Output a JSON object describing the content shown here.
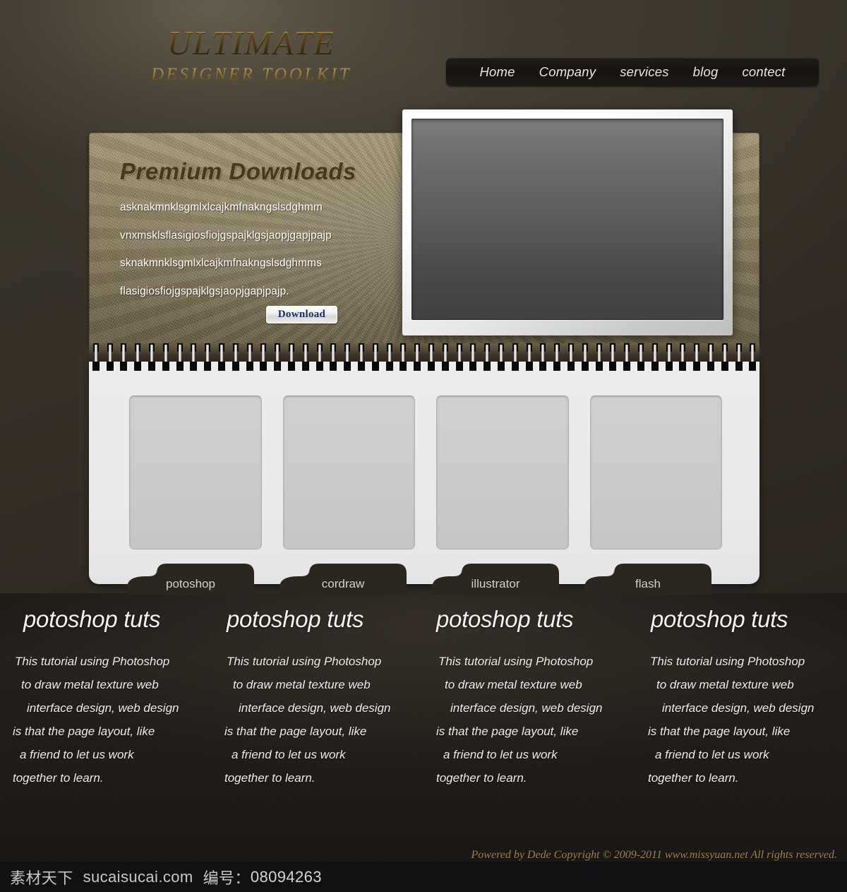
{
  "logo": {
    "line1": "ULTIMATE",
    "line2": "DESIGNER TOOLKIT"
  },
  "nav": {
    "items": [
      {
        "label": "Home"
      },
      {
        "label": "Company"
      },
      {
        "label": "services"
      },
      {
        "label": "blog"
      },
      {
        "label": "contect"
      }
    ]
  },
  "promo": {
    "heading": "Premium Downloads",
    "lines": [
      "asknakmnklsgmlxlcajkmfnakngslsdghmm",
      "vnxmsklsflasigiosfiojgspajklgsjaopjgapjpajp",
      "sknakmnklsgmlxlcajkmfnakngslsdghmms",
      "flasigiosfiojgspajklgsjaopjgapjpajp."
    ],
    "download_label": "Download"
  },
  "showcase": {
    "screen_name": "preview-screen",
    "thumbnails": [
      {
        "name": "thumbnail-1"
      },
      {
        "name": "thumbnail-2"
      },
      {
        "name": "thumbnail-3"
      },
      {
        "name": "thumbnail-4"
      }
    ]
  },
  "tabs": [
    {
      "label": "potoshop"
    },
    {
      "label": "cordraw"
    },
    {
      "label": "illustrator"
    },
    {
      "label": "flash"
    }
  ],
  "columns": [
    {
      "heading": "potoshop tuts",
      "body": [
        "This tutorial using Photoshop",
        "to draw metal texture web",
        "interface design, web design",
        "is that the page layout, like",
        "a friend to let us work",
        "together to learn."
      ]
    },
    {
      "heading": "potoshop tuts",
      "body": [
        "This tutorial using Photoshop",
        "to draw metal texture web",
        "interface design, web design",
        "is that the page layout, like",
        "a friend to let us work",
        "together to learn."
      ]
    },
    {
      "heading": "potoshop tuts",
      "body": [
        "This tutorial using Photoshop",
        "to draw metal texture web",
        "interface design, web design",
        "is that the page layout, like",
        "a friend to let us work",
        "together to learn."
      ]
    },
    {
      "heading": "potoshop tuts",
      "body": [
        "This tutorial using Photoshop",
        "to draw metal texture web",
        "interface design, web design",
        "is that the page layout, like",
        "a friend to let us work",
        "together to learn."
      ]
    }
  ],
  "footer": {
    "text": "Powered by Dede Copyright © 2009-2011 www.missyuan.net All rights reserved."
  },
  "watermark": {
    "site_cn": "素材天下",
    "site": "sucaisucai.com",
    "id_label": "编号：",
    "id_value": "08094263"
  },
  "colors": {
    "page_bg": "#2b2620",
    "cork": "#9a8b67",
    "heading_brown": "#4a3618",
    "gold": "#b5893b",
    "notepad": "#ececec",
    "thumb": "#cbcbcb",
    "tab_dark": "#2b2620",
    "download_text": "#1c2c66",
    "footer_gold": "#9e8558",
    "watermark_bar": "#111111"
  }
}
